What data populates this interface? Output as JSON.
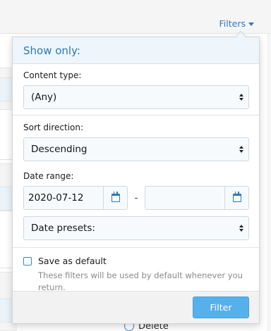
{
  "trigger": {
    "label": "Filters"
  },
  "popup": {
    "title": "Show only:",
    "content_type": {
      "label": "Content type:",
      "value": "(Any)"
    },
    "sort_direction": {
      "label": "Sort direction:",
      "value": "Descending"
    },
    "date_range": {
      "label": "Date range:",
      "start": "2020-07-12",
      "separator": "-",
      "end": "",
      "presets_value": "Date presets:"
    },
    "save_default": {
      "label": "Save as default",
      "hint": "These filters will be used by default whenever you return.",
      "checked": false
    },
    "filter_button": "Filter"
  },
  "background": {
    "delete_label": "Delete"
  },
  "colors": {
    "accent": "#2a7ab8",
    "button": "#56b0ea",
    "header_bg": "#eef5fb"
  }
}
